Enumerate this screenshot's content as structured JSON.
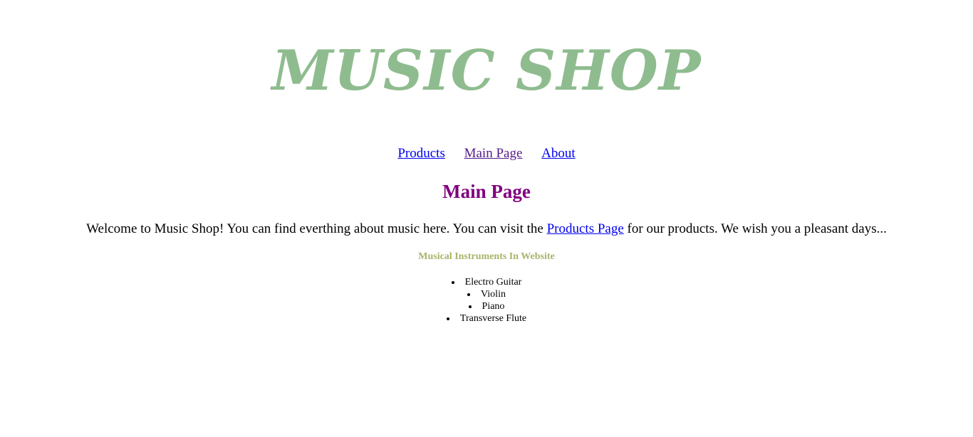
{
  "header": {
    "logo_text": "MUSIC SHOP"
  },
  "nav": {
    "items": [
      {
        "label": "Products"
      },
      {
        "label": "Main Page"
      },
      {
        "label": "About"
      }
    ]
  },
  "main": {
    "title": "Main Page",
    "welcome_before": "Welcome to Music Shop! You can find everthing about music here. You can visit the ",
    "welcome_link": "Products Page",
    "welcome_after": " for our products. We wish you a pleasant days...",
    "instruments_heading": "Musical Instruments In Website",
    "instruments": [
      "Electro Guitar",
      "Violin",
      "Piano",
      "Transverse Flute"
    ]
  },
  "colors": {
    "logo": "#8fbc8f",
    "title": "#800080",
    "subheading": "#a8b46a",
    "link": "#0000ee",
    "visited_link": "#551a8b"
  }
}
